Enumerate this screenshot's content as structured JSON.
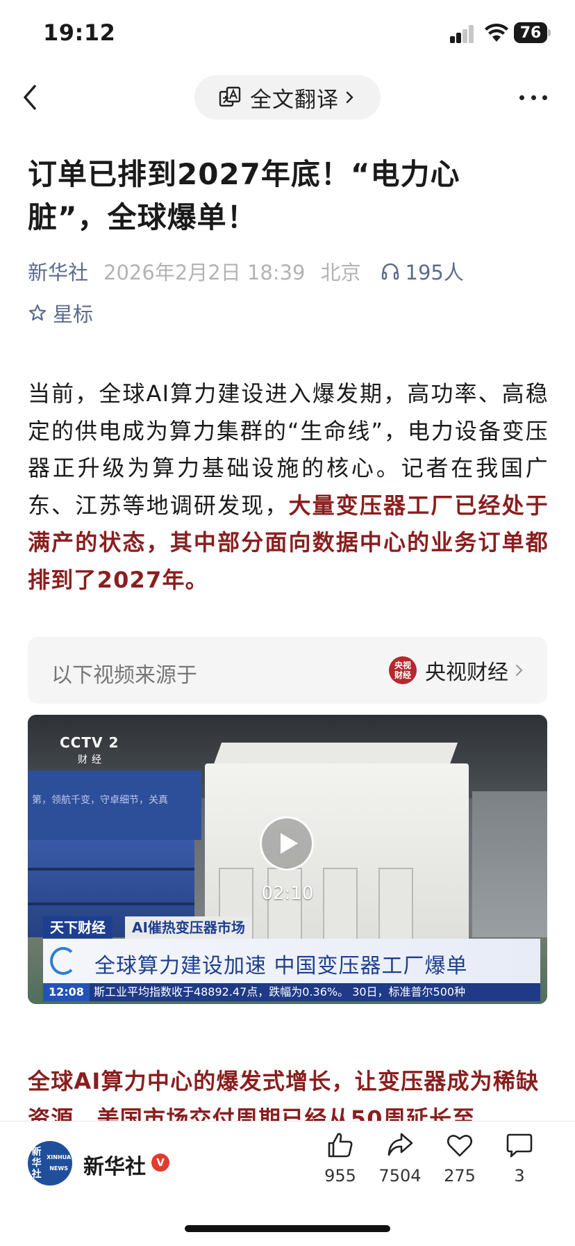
{
  "status_bar": {
    "time": "19:12",
    "battery": "76"
  },
  "nav": {
    "translate_label": "全文翻译"
  },
  "article": {
    "title": "订单已排到2027年底！“电力心脏”，全球爆单！",
    "source": "新华社",
    "date": "2026年2月2日 18:39",
    "city": "北京",
    "listeners": "195人",
    "star_label": "星标",
    "paragraph_plain": "当前，全球AI算力建设进入爆发期，高功率、高稳定的供电成为算力集群的“生命线”，电力设备变压器正升级为算力基础设施的核心。记者在我国广东、江苏等地调研发现，",
    "paragraph_highlight": "大量变压器工厂已经处于满产的状态，其中部分面向数据中心的业务订单都排到了2027年。",
    "paragraph2": "全球AI算力中心的爆发式增长，让变压器成为稀缺资源，美国市场交付周期已经从50周延长至"
  },
  "video_source": {
    "label": "以下视频来源于",
    "channel": "央视财经",
    "channel_logo_text": "央视\n财经"
  },
  "video": {
    "channel_logo": "CCTV 2",
    "channel_sub": "财经",
    "duration": "02:10",
    "tag_program": "天下财经",
    "tag_topic": "AI催热变压器市场",
    "headline": "全球算力建设加速 中国变压器工厂爆单",
    "ticker_time": "12:08",
    "ticker_text": "斯工业平均指数收于48892.47点，跌幅为0.36%。 30日，标准普尔500种",
    "wall_text": "第，领航千变，守卓细节，关真"
  },
  "bottom_bar": {
    "account_name": "新华社",
    "avatar_text": "新华社\nXINHUA NEWS",
    "verified_badge": "V",
    "likes": "955",
    "shares": "7504",
    "favorites": "275",
    "comments": "3"
  },
  "colors": {
    "highlight_red": "#8a1e1e",
    "meta_blue": "#5b6b8c",
    "cctv_blue": "#1e3f8f",
    "verified_red": "#e23b2e"
  },
  "icons": [
    "back-icon",
    "translate-icon",
    "more-icon",
    "headphones-icon",
    "star-icon",
    "play-icon",
    "like-icon",
    "share-icon",
    "heart-icon",
    "comment-icon"
  ]
}
